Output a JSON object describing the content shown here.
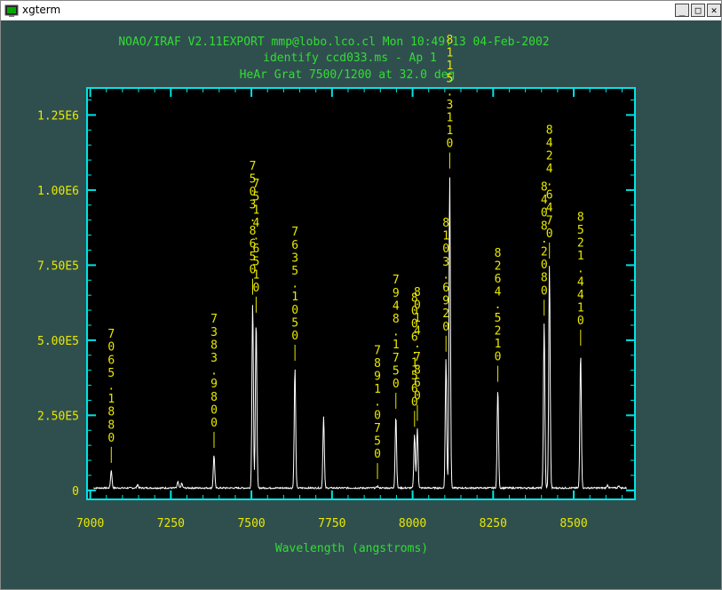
{
  "window": {
    "title": "xgterm",
    "minimize_glyph": "_",
    "maximize_glyph": "□",
    "close_glyph": "✕"
  },
  "header": {
    "line1": "NOAO/IRAF V2.11EXPORT mmp@lobo.lco.cl Mon 10:49:13 04-Feb-2002",
    "line2": "identify ccd033.ms - Ap 1",
    "line3": "HeAr Grat 7500/1200 at 32.0 deg"
  },
  "colors": {
    "background": "#2f4f4f",
    "plot_bg": "#000000",
    "frame": "#00e5e5",
    "header_text": "#33dd33",
    "tick_labels": "#e8e800",
    "line_ids": "#e8e800",
    "spectrum": "#ffffff"
  },
  "chart_data": {
    "type": "line",
    "xlabel": "Wavelength (angstroms)",
    "ylabel": "",
    "xlim": [
      6990,
      8690
    ],
    "ylim": [
      -30000,
      1340000
    ],
    "x_ticks": [
      7000,
      7250,
      7500,
      7750,
      8000,
      8250,
      8500
    ],
    "x_tick_labels": [
      "7000",
      "7250",
      "7500",
      "7750",
      "8000",
      "8250",
      "8500"
    ],
    "y_ticks": [
      0,
      250000,
      500000,
      750000,
      1000000,
      1250000
    ],
    "y_tick_labels": [
      "0",
      "2.50E5",
      "5.00E5",
      "7.50E5",
      "1.00E6",
      "1.25E6"
    ],
    "baseline": 8000,
    "peaks": [
      {
        "x": 7065.2,
        "y": 60000
      },
      {
        "x": 7147,
        "y": 12000
      },
      {
        "x": 7272,
        "y": 20000
      },
      {
        "x": 7284,
        "y": 15000
      },
      {
        "x": 7383.98,
        "y": 110000
      },
      {
        "x": 7503.87,
        "y": 620000
      },
      {
        "x": 7514.65,
        "y": 560000
      },
      {
        "x": 7635.1,
        "y": 400000
      },
      {
        "x": 7724,
        "y": 240000
      },
      {
        "x": 7891.08,
        "y": 6000
      },
      {
        "x": 7948.18,
        "y": 240000
      },
      {
        "x": 8006.16,
        "y": 180000
      },
      {
        "x": 8014.79,
        "y": 200000
      },
      {
        "x": 8103.69,
        "y": 430000
      },
      {
        "x": 8115.31,
        "y": 1040000
      },
      {
        "x": 8264.52,
        "y": 330000
      },
      {
        "x": 8408.21,
        "y": 550000
      },
      {
        "x": 8424.65,
        "y": 740000
      },
      {
        "x": 8521.44,
        "y": 450000
      },
      {
        "x": 8605,
        "y": 10000
      },
      {
        "x": 8640,
        "y": 8000
      }
    ],
    "line_ids": [
      {
        "x": 7065.2,
        "label": "7065.1880"
      },
      {
        "x": 7383.98,
        "label": "7383.9800"
      },
      {
        "x": 7503.87,
        "label": "7503.8650"
      },
      {
        "x": 7514.65,
        "label": "7514.6510"
      },
      {
        "x": 7635.1,
        "label": "7635.1050"
      },
      {
        "x": 7891.08,
        "label": "7891.0750"
      },
      {
        "x": 7948.18,
        "label": "7948.1750"
      },
      {
        "x": 8006.16,
        "label": "8006.1560"
      },
      {
        "x": 8014.79,
        "label": "8014.7860"
      },
      {
        "x": 8103.69,
        "label": "8103.6920"
      },
      {
        "x": 8115.31,
        "label": "8115.3110"
      },
      {
        "x": 8264.52,
        "label": "8264.5210"
      },
      {
        "x": 8408.21,
        "label": "8408.2080"
      },
      {
        "x": 8424.65,
        "label": "8424.6470"
      },
      {
        "x": 8521.44,
        "label": "8521.4410"
      }
    ]
  }
}
